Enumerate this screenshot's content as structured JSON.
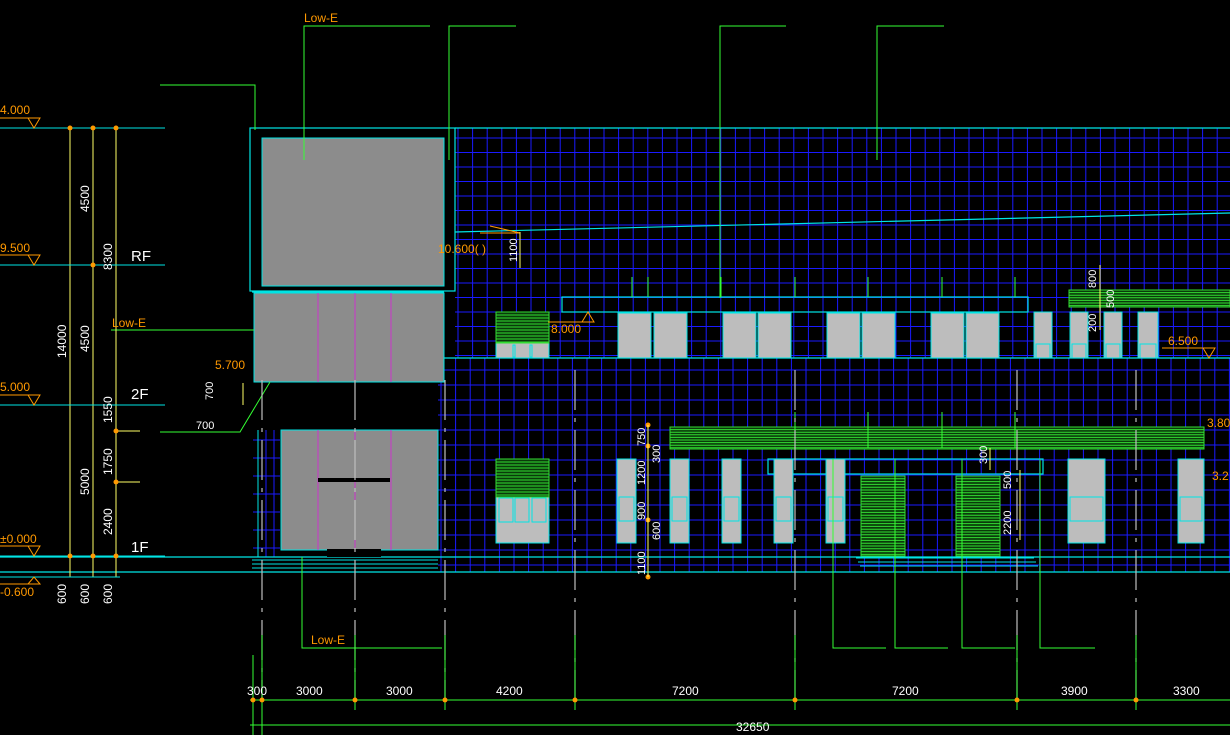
{
  "drawing": {
    "background": "#000000",
    "colors": {
      "curtain_grid": "#1a1aff",
      "outline": "#00e5e5",
      "leader": "#33ff33",
      "annotation": "#ff9900",
      "dimension": "#ffffff",
      "panel": "#8c8c8c",
      "louver": "#33dd33"
    },
    "level_marks": [
      "4.000",
      "9.500",
      "5.000",
      "±0.000",
      "-0.600"
    ],
    "floor_labels": {
      "rf": "RF",
      "f2": "2F",
      "f1": "1F"
    },
    "material_labels": {
      "top": "Low-E",
      "middle": "Low-E",
      "bottom": "Low-E"
    },
    "elevation_labels": {
      "canopy_upper": "8.000",
      "canopy_lower": "5.700",
      "roof_mid": "10.600(   )",
      "right_mid": "6.500",
      "right_top": "3.80",
      "right_bottom": "3.2"
    },
    "left_vertical_dims": {
      "col1": [
        "4500",
        "4500",
        "1550",
        "5000",
        "600"
      ],
      "col1_total": "14000",
      "col2": [
        "8300",
        "1750",
        "2400",
        "600"
      ],
      "col3": [
        "600"
      ]
    },
    "local_dims": {
      "d1100": "1100",
      "d700a": "700",
      "d700b": "700",
      "d800": "800",
      "d500a": "500",
      "d200": "200",
      "d750": "750",
      "d300a": "300",
      "d1200": "1200",
      "d900": "900",
      "d600": "600",
      "d1100b": "1100",
      "d300b": "300",
      "d500b": "500",
      "d2200": "2200"
    },
    "bottom_dims": {
      "segments": [
        "300",
        "3000",
        "3000",
        "4200",
        "7200",
        "7200",
        "3900",
        "3300"
      ],
      "total": "32650"
    }
  }
}
